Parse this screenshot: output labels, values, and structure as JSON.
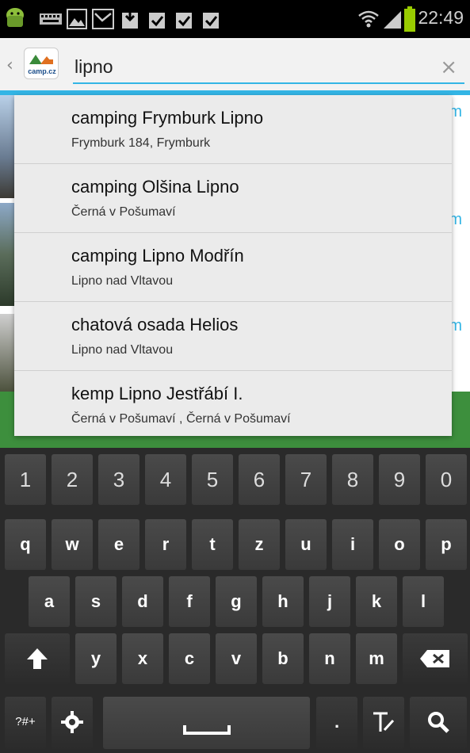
{
  "status_bar": {
    "time": "22:49",
    "icons": [
      "android-icon",
      "keyboard-icon",
      "image-icon",
      "missed-call-icon",
      "download-icon",
      "download-icon",
      "check-icon",
      "check-icon",
      "check-icon",
      "wifi-icon",
      "signal-icon",
      "battery-icon"
    ]
  },
  "action_bar": {
    "back_glyph": "‹",
    "logo_text": "camp.cz",
    "search_value": "lipno",
    "clear_glyph": "×"
  },
  "suggestions": [
    {
      "title": "camping Frymburk Lipno",
      "subtitle": "Frymburk 184, Frymburk"
    },
    {
      "title": "camping Olšina Lipno",
      "subtitle": "Černá v Pošumaví"
    },
    {
      "title": "camping Lipno Modřín",
      "subtitle": "Lipno nad Vltavou"
    },
    {
      "title": "chatová osada Helios",
      "subtitle": "Lipno nad Vltavou"
    },
    {
      "title": "kemp Lipno Jestřábí I.",
      "subtitle": "Černá v Pošumaví , Černá v Pošumaví"
    }
  ],
  "background": {
    "partial_letters": [
      "m",
      "m",
      "m"
    ]
  },
  "keyboard": {
    "row_numbers": [
      "1",
      "2",
      "3",
      "4",
      "5",
      "6",
      "7",
      "8",
      "9",
      "0"
    ],
    "row_1": [
      "q",
      "w",
      "e",
      "r",
      "t",
      "z",
      "u",
      "i",
      "o",
      "p"
    ],
    "row_2": [
      "a",
      "s",
      "d",
      "f",
      "g",
      "h",
      "j",
      "k",
      "l"
    ],
    "row_3": [
      "y",
      "x",
      "c",
      "v",
      "b",
      "n",
      "m"
    ],
    "symbols_label": "?#+",
    "period_label": "."
  },
  "colors": {
    "accent": "#33b5e5",
    "action_bar_bg": "#f2f2f2",
    "dropdown_bg": "#ebebeb",
    "keyboard_bg": "#2a2a2a",
    "green_bar": "#3d8f3d"
  }
}
